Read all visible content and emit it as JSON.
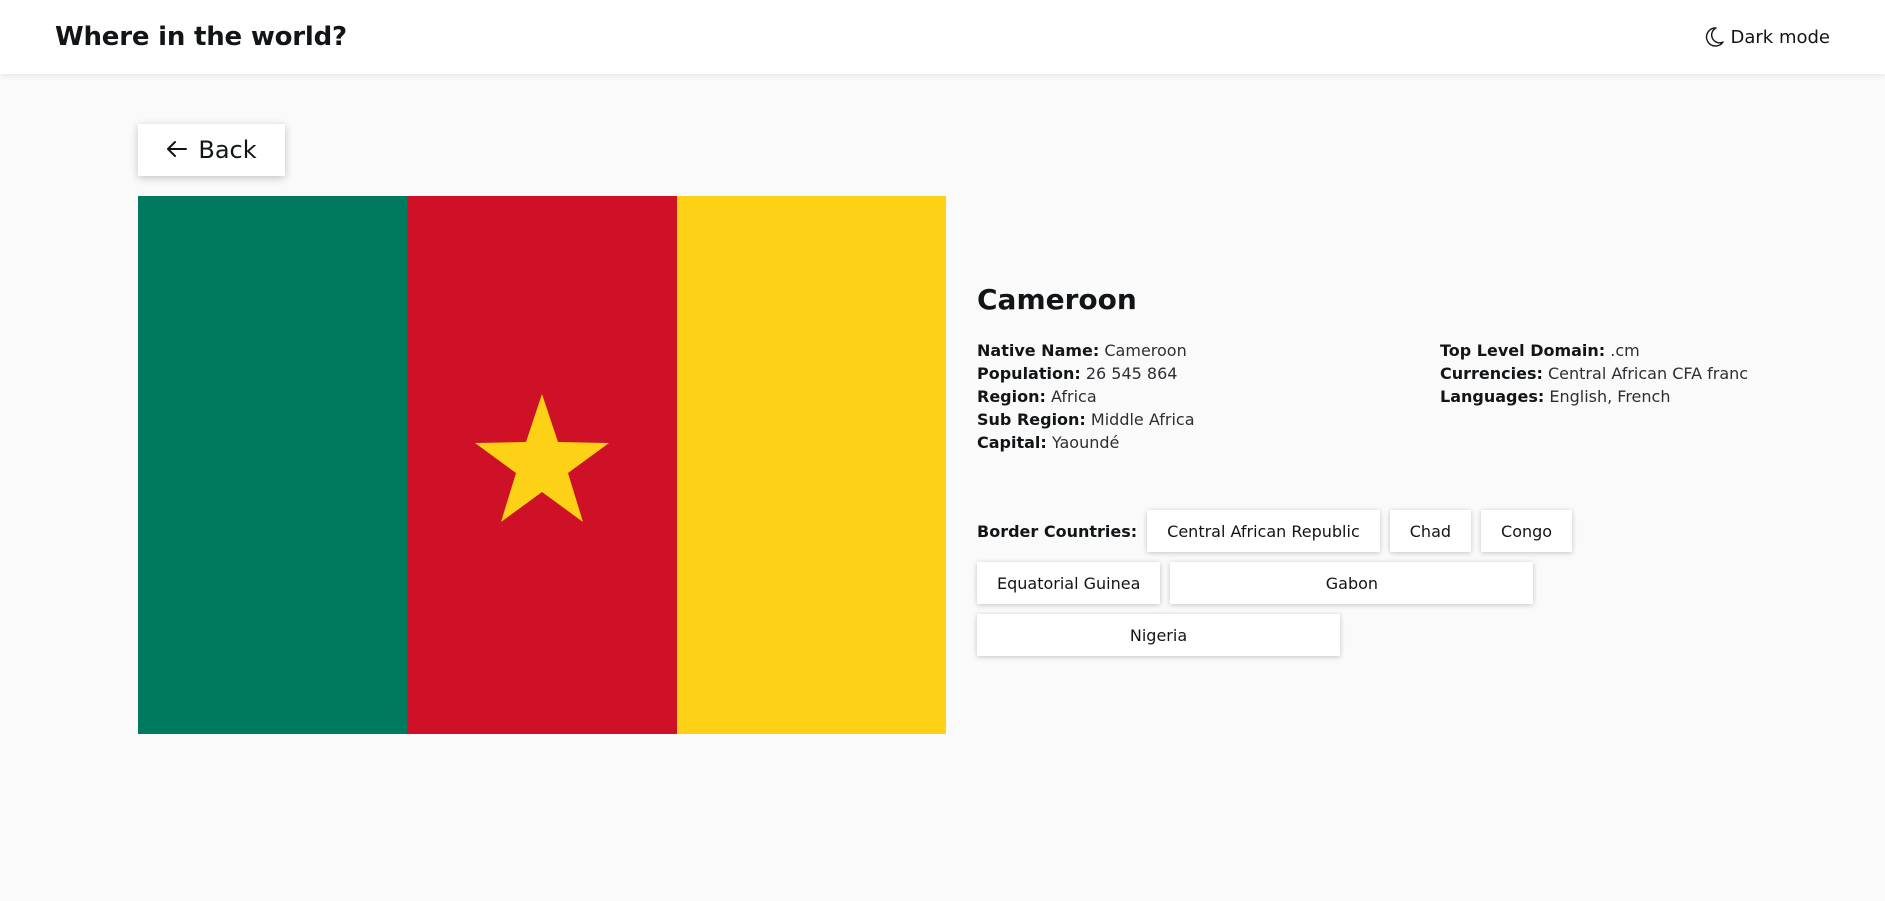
{
  "header": {
    "title": "Where in the world?",
    "theme_toggle_label": "Dark mode",
    "theme_toggle_icon": "moon-icon"
  },
  "back": {
    "label": "Back",
    "icon": "arrow-left-icon"
  },
  "flag": {
    "country": "Cameroon",
    "colors": {
      "green": "#007a5e",
      "red": "#ce1126",
      "yellow": "#fcd116"
    }
  },
  "country": {
    "name": "Cameroon",
    "fields_left": [
      {
        "label": "Native Name:",
        "value": "Cameroon"
      },
      {
        "label": "Population:",
        "value": "26 545 864"
      },
      {
        "label": "Region:",
        "value": "Africa"
      },
      {
        "label": "Sub Region:",
        "value": "Middle Africa"
      },
      {
        "label": "Capital:",
        "value": "Yaoundé"
      }
    ],
    "fields_right": [
      {
        "label": "Top Level Domain:",
        "value": ".cm"
      },
      {
        "label": "Currencies:",
        "value": "Central African CFA franc"
      },
      {
        "label": "Languages:",
        "value": "English, French"
      }
    ],
    "border_label": "Border Countries:",
    "borders": [
      "Central African Republic",
      "Chad",
      "Congo",
      "Equatorial Guinea",
      "Gabon",
      "Nigeria"
    ]
  },
  "colors": {
    "page_bg": "#fafafa",
    "card_bg": "#ffffff",
    "text": "#111517"
  }
}
